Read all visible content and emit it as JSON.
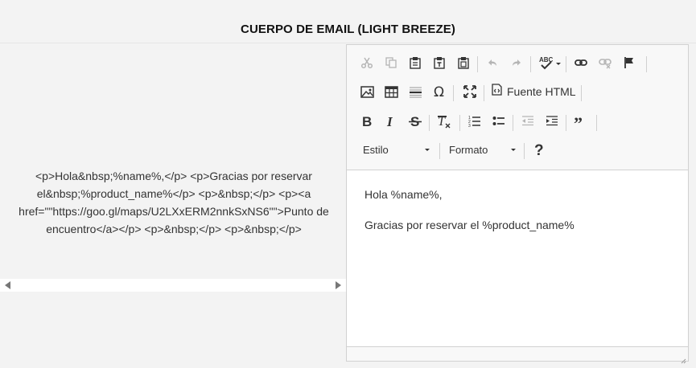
{
  "section": {
    "title": "CUERPO DE EMAIL (LIGHT BREEZE)"
  },
  "source_preview": {
    "text": "<p>Hola&nbsp;%name%,</p> <p>Gracias por reservar el&nbsp;%product_name%</p> <p>&nbsp;</p> <p><a href=\"\"https://goo.gl/maps/U2LXxERM2nnkSxNS6\"\">Punto de encuentro</a></p> <p>&nbsp;</p> <p>&nbsp;</p>"
  },
  "toolbar": {
    "source_label": "Fuente HTML",
    "style_combo": "Estilo",
    "format_combo": "Formato",
    "icons": {
      "cut": "cut-icon",
      "copy": "copy-icon",
      "paste": "paste-icon",
      "paste_text": "paste-text-icon",
      "paste_word": "paste-word-icon",
      "undo": "undo-icon",
      "redo": "redo-icon",
      "spellcheck": "spellcheck-icon",
      "link": "link-icon",
      "unlink": "unlink-icon",
      "anchor": "flag-icon",
      "image": "image-icon",
      "table": "table-icon",
      "hr": "horizontal-rule-icon",
      "special_char": "omega-icon",
      "maximize": "maximize-icon",
      "source": "source-icon",
      "bold": "bold-icon",
      "italic": "italic-icon",
      "strike": "strikethrough-icon",
      "remove_format": "remove-format-icon",
      "numbered_list": "numbered-list-icon",
      "bulleted_list": "bulleted-list-icon",
      "outdent": "outdent-icon",
      "indent": "indent-icon",
      "blockquote": "blockquote-icon",
      "help": "help-icon"
    }
  },
  "editor": {
    "paragraphs": [
      "Hola %name%,",
      "Gracias por reservar el %product_name%"
    ]
  },
  "colors": {
    "icon": "#333333",
    "icon_disabled": "#b5b5b5",
    "toolbar_bg": "#f8f8f8",
    "border": "#d1d1d1"
  }
}
